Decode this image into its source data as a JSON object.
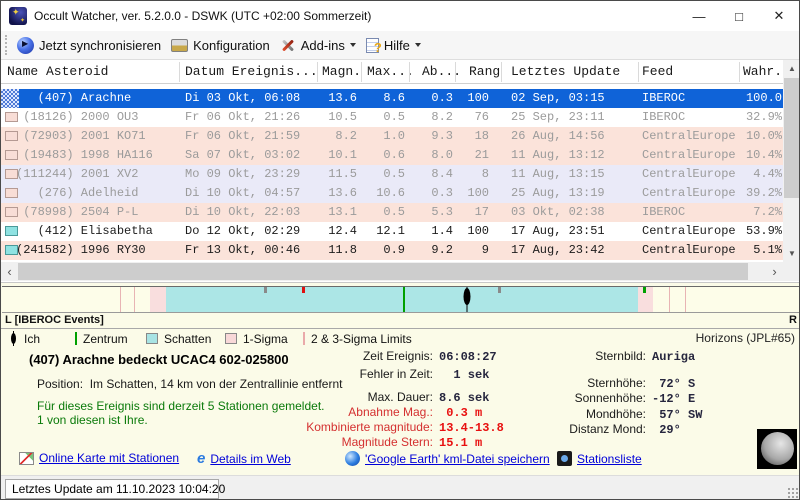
{
  "window": {
    "title": "Occult Watcher, ver. 5.2.0.0 - DSWK (UTC +02:00 Sommerzeit)",
    "controls": [
      {
        "name": "minimize",
        "glyph": "—"
      },
      {
        "name": "maximize",
        "glyph": "□"
      },
      {
        "name": "close",
        "glyph": "✕"
      }
    ]
  },
  "toolbar": {
    "buttons": [
      {
        "label": "Jetzt synchronisieren",
        "icon": "sync-icon",
        "dropdown": false
      },
      {
        "label": "Konfiguration",
        "icon": "config-icon",
        "dropdown": false
      },
      {
        "label": "Add-ins",
        "icon": "tools-icon",
        "dropdown": true
      },
      {
        "label": "Hilfe",
        "icon": "help-icon",
        "dropdown": true
      }
    ]
  },
  "table": {
    "columns": [
      "Name Asteroid",
      "Datum Ereignis...",
      "Magn.",
      "Max...",
      "Ab...",
      "Rang",
      "Letztes Update",
      "Feed",
      "Wahr."
    ],
    "rows": [
      {
        "icon": "dither",
        "bg": "selected",
        "text": "white",
        "cells": [
          "   (407) Arachne",
          "Di 03 Okt, 06:08",
          "13.6",
          "8.6",
          "0.3",
          "100",
          "02 Sep, 03:15",
          "IBEROC",
          "100.0"
        ]
      },
      {
        "icon": "pinkbox",
        "bg": "white",
        "text": "gray",
        "cells": [
          " (18126) 2000 OU3",
          "Fr 06 Okt, 21:26",
          "10.5",
          "0.5",
          "8.2",
          "76",
          "25 Sep, 23:11",
          "IBEROC",
          "32.9%"
        ]
      },
      {
        "icon": "pinkbox",
        "bg": "pink",
        "text": "gray",
        "cells": [
          " (72903) 2001 KO71",
          "Fr 06 Okt, 21:59",
          "8.2",
          "1.0",
          "9.3",
          "18",
          "26 Aug, 14:56",
          "CentralEurope",
          "10.0%"
        ]
      },
      {
        "icon": "pinkbox",
        "bg": "pink",
        "text": "gray",
        "cells": [
          " (19483) 1998 HA116",
          "Sa 07 Okt, 03:02",
          "10.1",
          "0.6",
          "8.0",
          "21",
          "11 Aug, 13:12",
          "CentralEurope",
          "10.4%"
        ]
      },
      {
        "icon": "pinkbox",
        "bg": "lavender",
        "text": "gray",
        "cells": [
          "(111244) 2001 XV2",
          "Mo 09 Okt, 23:29",
          "11.5",
          "0.5",
          "8.4",
          "8",
          "11 Aug, 13:15",
          "CentralEurope",
          "4.4%"
        ]
      },
      {
        "icon": "pinkbox",
        "bg": "lavender",
        "text": "gray",
        "cells": [
          "   (276) Adelheid",
          "Di 10 Okt, 04:57",
          "13.6",
          "10.6",
          "0.3",
          "100",
          "25 Aug, 13:19",
          "CentralEurope",
          "39.2%"
        ]
      },
      {
        "icon": "pinkbox",
        "bg": "pink",
        "text": "gray",
        "cells": [
          " (78998) 2504 P-L",
          "Di 10 Okt, 22:03",
          "13.1",
          "0.5",
          "5.3",
          "17",
          "03 Okt, 02:38",
          "IBEROC",
          "7.2%"
        ]
      },
      {
        "icon": "cyanbox",
        "bg": "white",
        "text": "black",
        "cells": [
          "   (412) Elisabetha",
          "Do 12 Okt, 02:29",
          "12.4",
          "12.1",
          "1.4",
          "100",
          "17 Aug, 23:51",
          "CentralEurope",
          "53.9%"
        ]
      },
      {
        "icon": "cyanbox",
        "bg": "pink",
        "text": "black",
        "cells": [
          "(241582) 1996 RY30",
          "Fr 13 Okt, 00:46",
          "11.8",
          "0.9",
          "9.2",
          "9",
          "17 Aug, 23:42",
          "CentralEurope",
          "5.1%"
        ]
      }
    ]
  },
  "timeline": {
    "left_label": "L [IBEROC Events]",
    "right_label": "R",
    "horizons": "Horizons (JPL#65)",
    "bands": [
      {
        "type": "sigma1",
        "from": 18.6,
        "to": 20.6
      },
      {
        "type": "shadow",
        "from": 20.6,
        "to": 79.8
      },
      {
        "type": "sigma1",
        "from": 79.8,
        "to": 81.7
      }
    ],
    "lines": [
      {
        "type": "sigma23",
        "pos": 14.8
      },
      {
        "type": "sigma23",
        "pos": 16.5
      },
      {
        "type": "center",
        "pos": 50.3
      },
      {
        "type": "sigma23",
        "pos": 83.7
      },
      {
        "type": "sigma23",
        "pos": 85.7
      }
    ],
    "ticks": [
      {
        "color": "gray",
        "pos": 32.9
      },
      {
        "color": "red",
        "pos": 37.7
      },
      {
        "color": "gray",
        "pos": 62.2
      },
      {
        "color": "green",
        "pos": 80.4
      }
    ],
    "marker_pos": 58.3,
    "colors": {
      "shadow": "#ace6e6",
      "sigma1": "#f9dede",
      "center": "#00a000",
      "selection": "#0f63d8"
    }
  },
  "legend": {
    "items": [
      {
        "swatch": "ich",
        "label": "Ich"
      },
      {
        "swatch": "zentrum",
        "label": "Zentrum"
      },
      {
        "swatch": "schatten",
        "label": "Schatten"
      },
      {
        "swatch": "sigma1",
        "label": "1-Sigma"
      },
      {
        "swatch": "sigma23",
        "label": "2 & 3-Sigma Limits"
      }
    ]
  },
  "details": {
    "title": "(407) Arachne bedeckt UCAC4 602-025800",
    "position_line": "Position:  Im Schatten, 14 km von der Zentrallinie entfernt",
    "stations_line1": "Für dieses Ereignis sind derzeit 5 Stationen gemeldet.",
    "stations_line2": "1 von diesen ist Ihre.",
    "mid_fields": [
      {
        "label": "Zeit Ereignis:",
        "value": "06:08:27",
        "color": "black"
      },
      {
        "label": "Fehler in Zeit:",
        "value": "  1 sek",
        "color": "black"
      },
      {
        "label": "Max. Dauer:",
        "value": "8.6 sek",
        "color": "black"
      },
      {
        "label": "Abnahme Mag.:",
        "value": " 0.3 m",
        "color": "red"
      },
      {
        "label": "Kombinierte magnitude:",
        "value": "13.4-13.8",
        "color": "red"
      },
      {
        "label": "Magnitude Stern:",
        "value": "15.1 m",
        "color": "red"
      }
    ],
    "right_fields": [
      {
        "label": "Sternbild:",
        "value": "Auriga",
        "color": "black"
      },
      {
        "label": "Sternhöhe:",
        "value": " 72° S",
        "color": "black"
      },
      {
        "label": "Sonnenhöhe:",
        "value": "-12° E",
        "color": "black"
      },
      {
        "label": "Mondhöhe:",
        "value": " 57° SW",
        "color": "black"
      },
      {
        "label": "Distanz Mond:",
        "value": " 29°",
        "color": "black"
      }
    ]
  },
  "links": [
    {
      "icon": "map-icon",
      "label": "Online Karte mit Stationen"
    },
    {
      "icon": "ie-icon",
      "label": "Details im Web"
    },
    {
      "icon": "google-earth-icon",
      "label": "'Google Earth' kml-Datei speichern"
    },
    {
      "icon": "stations-icon",
      "label": "Stationsliste"
    }
  ],
  "statusbar": {
    "text": "Letztes Update am 11.10.2023 10:04:20"
  }
}
